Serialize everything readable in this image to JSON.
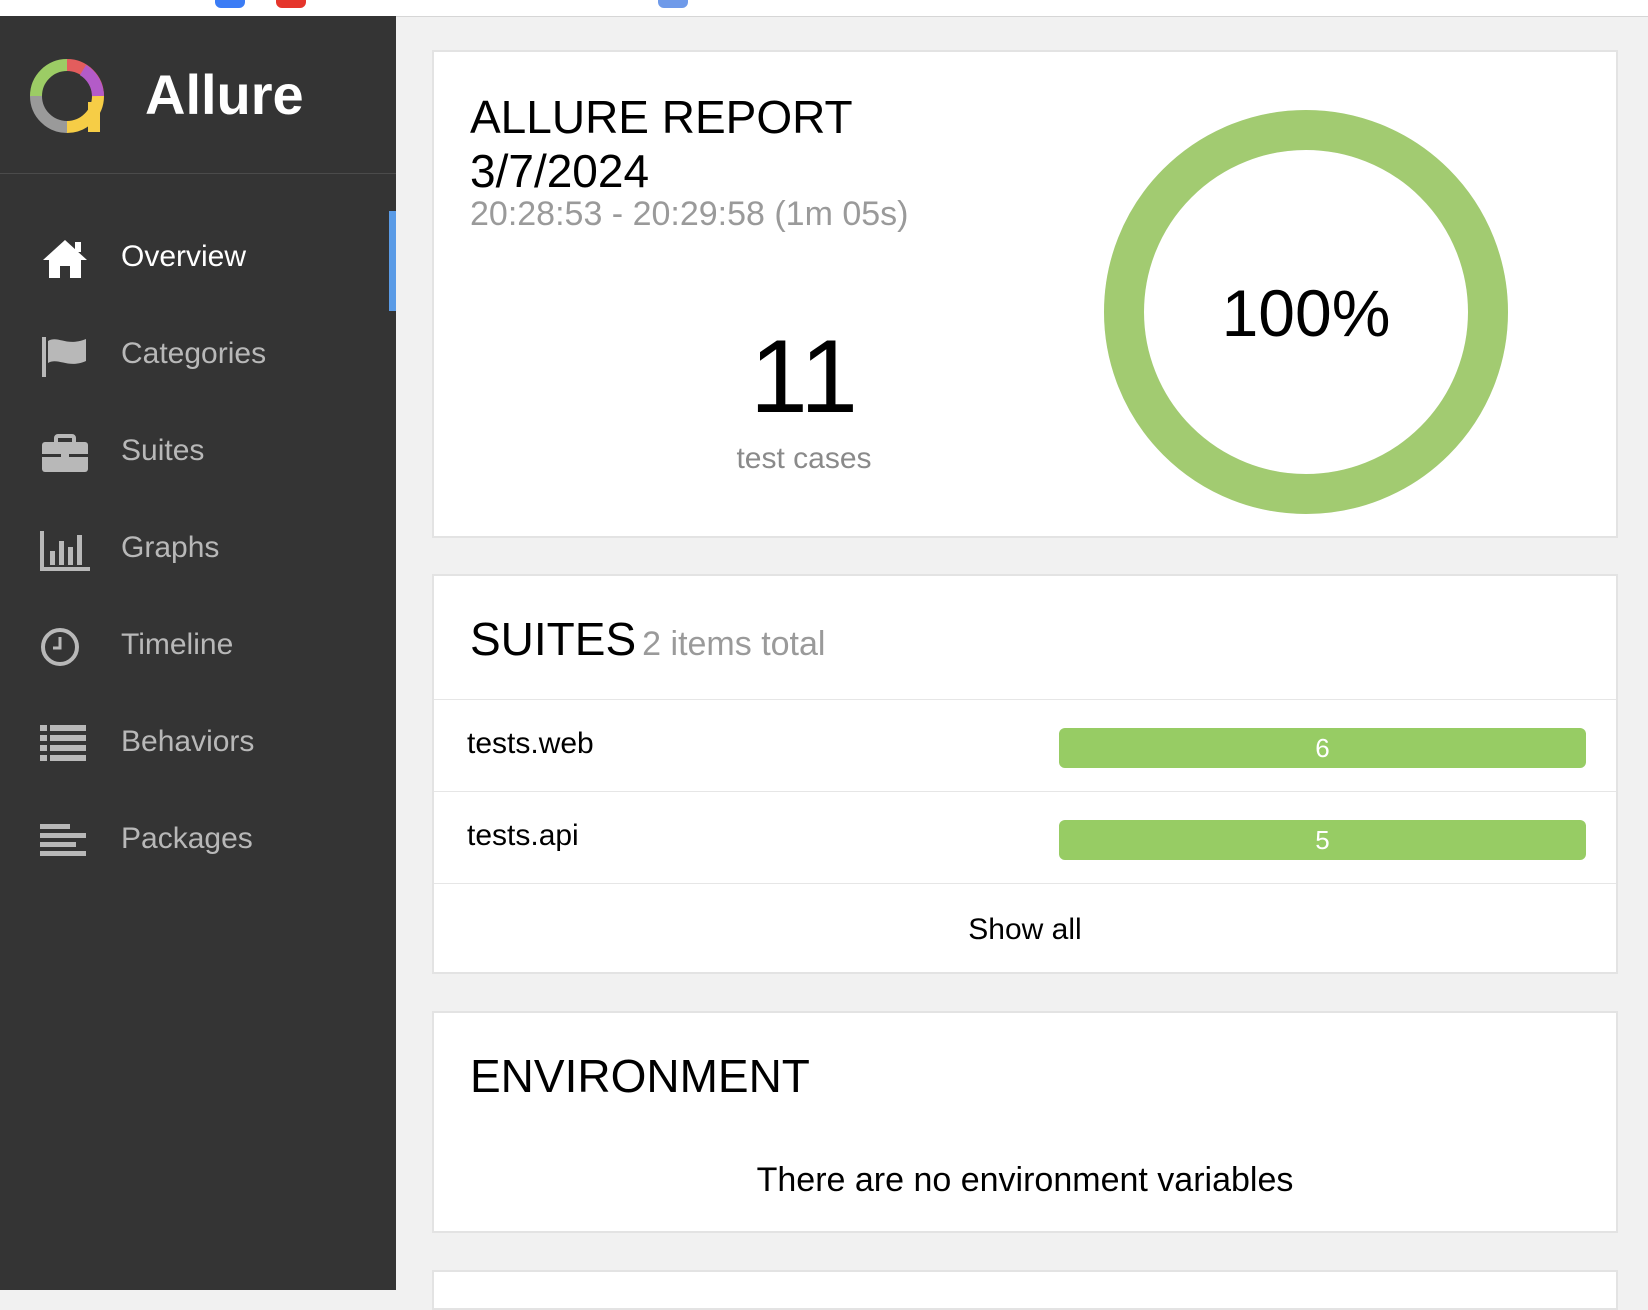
{
  "app": {
    "name": "Allure"
  },
  "sidebar": {
    "items": [
      {
        "label": "Overview",
        "icon": "home-icon",
        "active": true
      },
      {
        "label": "Categories",
        "icon": "flag-icon"
      },
      {
        "label": "Suites",
        "icon": "briefcase-icon"
      },
      {
        "label": "Graphs",
        "icon": "bar-chart-icon"
      },
      {
        "label": "Timeline",
        "icon": "clock-icon"
      },
      {
        "label": "Behaviors",
        "icon": "list-icon"
      },
      {
        "label": "Packages",
        "icon": "align-left-icon"
      }
    ]
  },
  "report": {
    "title_line1": "ALLURE REPORT",
    "date": "3/7/2024",
    "time_range": "20:28:53 - 20:29:58 (1m 05s)",
    "test_count": "11",
    "test_count_label": "test cases",
    "success_rate": "100%",
    "success_fraction": 1.0
  },
  "suites": {
    "title": "SUITES",
    "subtitle": "2 items total",
    "rows": [
      {
        "name": "tests.web",
        "passed": "6"
      },
      {
        "name": "tests.api",
        "passed": "5"
      }
    ],
    "show_all": "Show all"
  },
  "environment": {
    "title": "ENVIRONMENT",
    "empty_message": "There are no environment variables"
  },
  "colors": {
    "sidebar_bg": "#343434",
    "active_accent": "#5a9be6",
    "passed": "#97cc64",
    "donut": "#a2cb71"
  }
}
